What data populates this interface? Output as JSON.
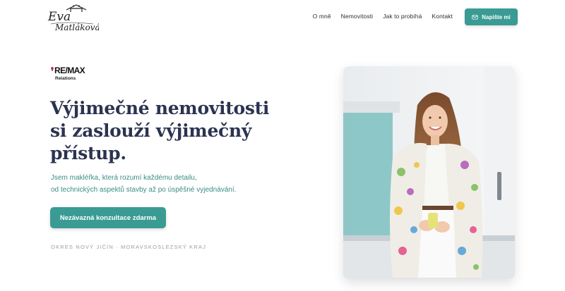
{
  "header": {
    "logo_line1": "Eva",
    "logo_line2": "Matláková",
    "nav": [
      "O mně",
      "Nemovitosti",
      "Jak to probíhá",
      "Kontakt"
    ],
    "contact_button": "Napište mi",
    "contact_icon": "mail-icon"
  },
  "brand": {
    "remax_word": "RE/MAX",
    "remax_sub": "Relations"
  },
  "hero": {
    "headline_line1": "Výjimečné nemovitosti",
    "headline_line2": "si zaslouží výjimečný",
    "headline_line3": "přístup.",
    "subtext_line1": "Jsem makléřka, která rozumí každému detailu,",
    "subtext_line2": "od technických aspektů stavby až po úspěšné vyjednávání.",
    "cta": "Nezávazná konzultace zdarma",
    "region": "OKRES NOVÝ JIČÍN · MORAVSKOSLEZSKÝ KRAJ"
  },
  "colors": {
    "accent": "#3a9b94",
    "headline": "#2b3350",
    "subtext": "#3a8d86",
    "muted": "#9aa0a8"
  }
}
